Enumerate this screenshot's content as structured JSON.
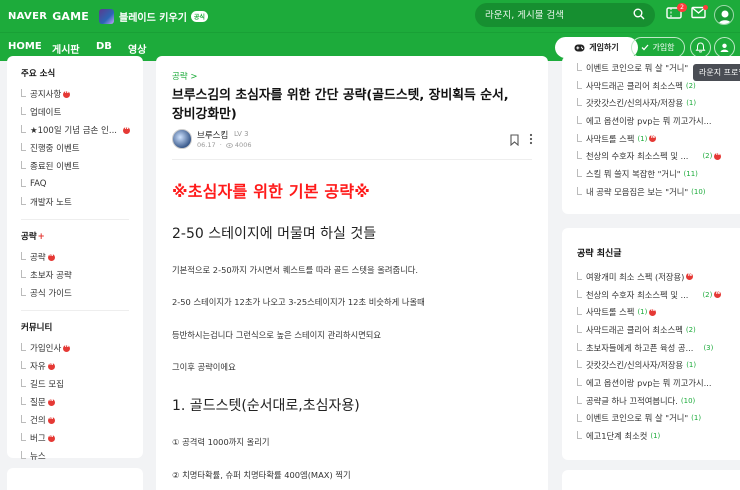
{
  "header": {
    "naver_label": "NAVER",
    "game_label": "GAME",
    "game_name": "블레이드 키우기",
    "official_badge": "공식",
    "search_placeholder": "라운지, 게시물 검색",
    "coupon_badge": "2",
    "brand_color": "#1dab3b"
  },
  "nav": {
    "tabs": [
      "HOME",
      "게시판",
      "DB",
      "영상"
    ],
    "active_tab": "게시판",
    "download_button": "게임하기",
    "join_button": "가입함",
    "tooltip": "라운지 프로필"
  },
  "sidebar": {
    "sections": [
      {
        "title": "주요 소식",
        "items": [
          {
            "label": "공지사항",
            "new": true
          },
          {
            "label": "업데이트",
            "new": false
          },
          {
            "label": "★100일 기념 금손 인...",
            "new": true
          },
          {
            "label": "진행중 이벤트",
            "new": false
          },
          {
            "label": "종료된 이벤트",
            "new": false
          },
          {
            "label": "FAQ",
            "new": false
          },
          {
            "label": "개발자 노트",
            "new": false
          }
        ]
      },
      {
        "title": "공략",
        "title_suffix": "+",
        "items": [
          {
            "label": "공략",
            "new": true
          },
          {
            "label": "초보자 공략",
            "new": false
          },
          {
            "label": "공식 가이드",
            "new": false
          }
        ]
      },
      {
        "title": "커뮤니티",
        "items": [
          {
            "label": "가입인사",
            "new": true
          },
          {
            "label": "자유",
            "new": true
          },
          {
            "label": "길드 모집",
            "new": false
          },
          {
            "label": "질문",
            "new": true
          },
          {
            "label": "건의",
            "new": true
          },
          {
            "label": "버그",
            "new": true
          },
          {
            "label": "뉴스",
            "new": false
          }
        ]
      }
    ]
  },
  "article": {
    "breadcrumb": "공략 >",
    "title": "브루스김의 초심자를 위한 간단 공략(골드스텟, 장비획득 순서, 장비강화만)",
    "author": "브루스킴",
    "level": "LV 3",
    "date": "06.17",
    "views": "4006",
    "red_heading": "※초심자를 위한 기본 공략※",
    "h2_stage": "2-50 스테이지에 머물며 하실 것들",
    "p1": "기본적으로 2-50까지 가시면서 퀘스트를 따라 골드 스텟을 올려줍니다.",
    "p2": "2-50 스테이지가 12초가 나오고 3-25스테이지가 12초 비슷하게 나올때",
    "p3": "등반하시는겁니다 그런식으로 높은 스테이지 관리하시면되요",
    "p4": "그이후 공략이에요",
    "h2_gold": "1. 골드스텟(순서대로,초심자용)",
    "p5": "① 공격력 1000까지 올리기",
    "p6": "② 치명타확률, 슈퍼 치명타확률 400엠(MAX) 찍기"
  },
  "right_top": {
    "items": [
      {
        "label": "이벤트 코인으로 뭐 살 \"거니\"",
        "count": "",
        "new": false
      },
      {
        "label": "사막드래곤 클리어 최소스펙",
        "count": "(2)",
        "new": false
      },
      {
        "label": "갓캇갓스킨/신의사자/저장용",
        "count": "(1)",
        "new": false
      },
      {
        "label": "에고 옵션이랑 pvp는 뭐 끼고가시...",
        "count": "",
        "new": false
      },
      {
        "label": "사막트롤 스펙",
        "count": "(1)",
        "new": true
      },
      {
        "label": "천상의 수호자 최소스펙 및 ...",
        "count": "(2)",
        "new": true
      },
      {
        "label": "스킬 뭐 쓸지 복잡한 \"거니\"",
        "count": "(11)",
        "new": false
      },
      {
        "label": "내 공략 모음집은 보는 \"거니\"",
        "count": "(10)",
        "new": false
      }
    ]
  },
  "right_strategy": {
    "title": "공략 최신글",
    "items": [
      {
        "label": "여왕개미 최소 스펙 (저장용)",
        "count": "",
        "new": true
      },
      {
        "label": "천상의 수호자 최소스펙 및 ...",
        "count": "(2)",
        "new": true
      },
      {
        "label": "사막트롤 스펙",
        "count": "(1)",
        "new": true
      },
      {
        "label": "사막드래곤 클리어 최소스펙",
        "count": "(2)",
        "new": false
      },
      {
        "label": "초보자들에게 하고픈 육성 공...",
        "count": "(3)",
        "new": false
      },
      {
        "label": "갓캇갓스킨/신의사자/저장용",
        "count": "(1)",
        "new": false
      },
      {
        "label": "에고 옵션이랑 pvp는 뭐 끼고가시...",
        "count": "",
        "new": false
      },
      {
        "label": "공략글 하나 끄적여봅니다.",
        "count": "(10)",
        "new": false
      },
      {
        "label": "이벤트 코인으로 뭐 살 \"거니\"",
        "count": "(1)",
        "new": false
      },
      {
        "label": "에고1단계 최소컷",
        "count": "(1)",
        "new": false
      }
    ]
  }
}
